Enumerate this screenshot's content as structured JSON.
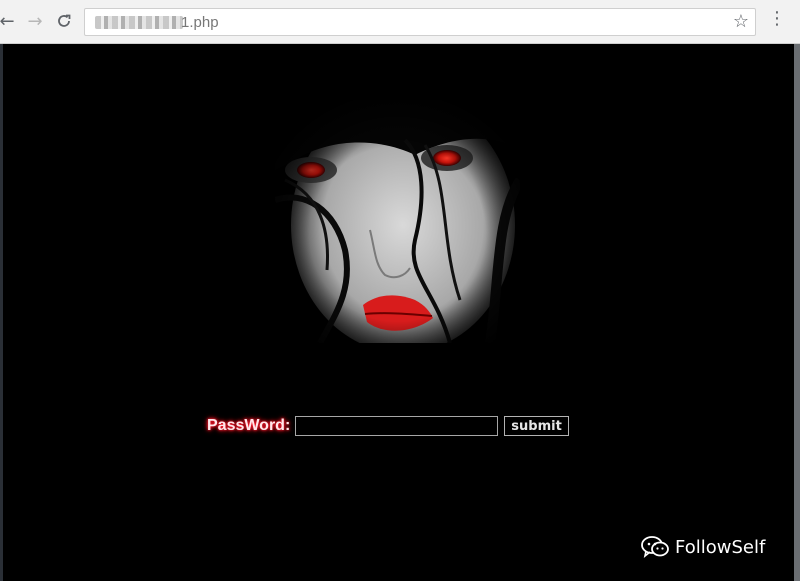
{
  "browser": {
    "url_visible": "1.php",
    "icons": {
      "back": "back-arrow-icon",
      "forward": "forward-arrow-icon",
      "reload": "reload-icon",
      "bookmark": "star-icon",
      "menu": "kebab-menu-icon"
    }
  },
  "page": {
    "background": "#000000",
    "password_label": "PassWord:",
    "password_value": "",
    "submit_label": "submit",
    "label_glow_color": "#ff1b2d"
  },
  "watermark": {
    "text": "FollowSelf",
    "icon": "wechat-icon"
  }
}
